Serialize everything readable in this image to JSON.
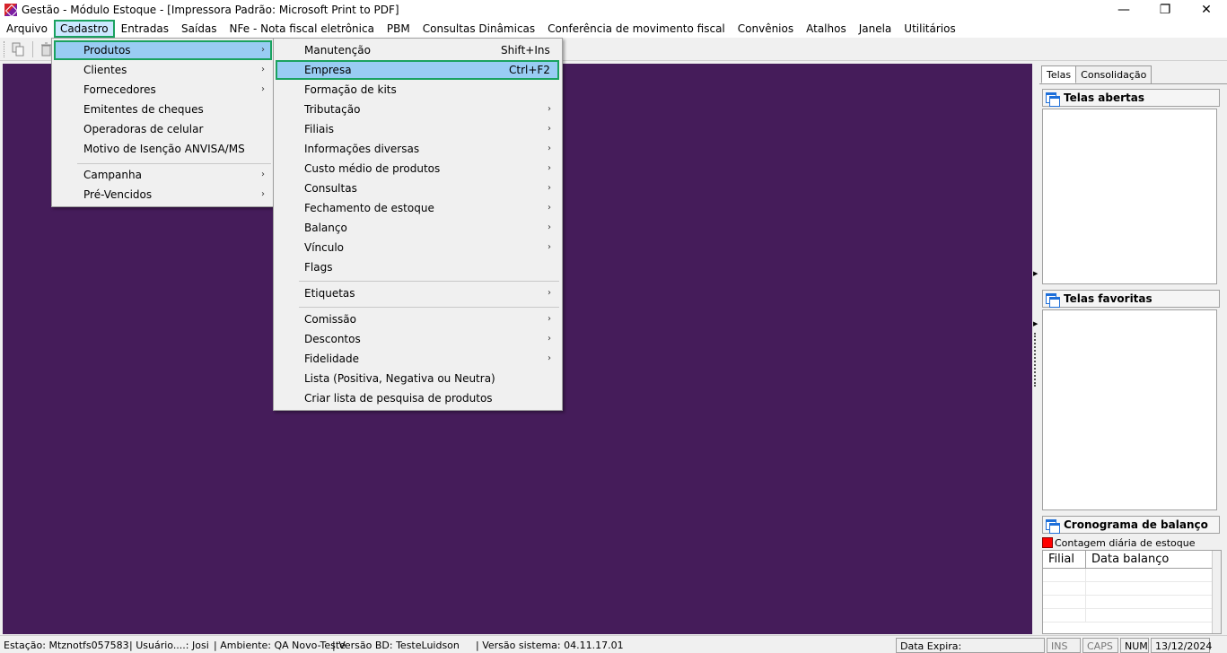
{
  "window": {
    "title": "Gestão  - Módulo Estoque - [Impressora Padrão: Microsoft Print to PDF]",
    "controls": {
      "minimize": "—",
      "maximize": "❐",
      "close": "✕"
    }
  },
  "menubar": {
    "items": [
      "Arquivo",
      "Cadastro",
      "Entradas",
      "Saídas",
      "NFe - Nota fiscal eletrônica",
      "PBM",
      "Consultas Dinâmicas",
      "Conferência de movimento fiscal",
      "Convênios",
      "Atalhos",
      "Janela",
      "Utilitários"
    ],
    "active": "Cadastro"
  },
  "cadastro_menu": {
    "items": [
      {
        "label": "Produtos",
        "submenu": true
      },
      {
        "label": "Clientes",
        "submenu": true
      },
      {
        "label": "Fornecedores",
        "submenu": true
      },
      {
        "label": "Emitentes de cheques",
        "submenu": false
      },
      {
        "label": "Operadoras de celular",
        "submenu": false
      },
      {
        "label": "Motivo de Isenção ANVISA/MS",
        "submenu": false
      },
      {
        "label": "Campanha",
        "submenu": true
      },
      {
        "label": "Pré-Vencidos",
        "submenu": true
      }
    ],
    "highlighted": "Produtos"
  },
  "produtos_menu": {
    "items": [
      {
        "label": "Manutenção",
        "shortcut": "Shift+Ins",
        "submenu": false
      },
      {
        "label": "Empresa",
        "shortcut": "Ctrl+F2",
        "submenu": false
      },
      {
        "label": "Formação de kits",
        "shortcut": "",
        "submenu": false
      },
      {
        "label": "Tributação",
        "shortcut": "",
        "submenu": true
      },
      {
        "label": "Filiais",
        "shortcut": "",
        "submenu": true
      },
      {
        "label": "Informações diversas",
        "shortcut": "",
        "submenu": true
      },
      {
        "label": "Custo médio de produtos",
        "shortcut": "",
        "submenu": true
      },
      {
        "label": "Consultas",
        "shortcut": "",
        "submenu": true
      },
      {
        "label": "Fechamento de estoque",
        "shortcut": "",
        "submenu": true
      },
      {
        "label": "Balanço",
        "shortcut": "",
        "submenu": true
      },
      {
        "label": "Vínculo",
        "shortcut": "",
        "submenu": true
      },
      {
        "label": "Flags",
        "shortcut": "",
        "submenu": false
      },
      {
        "label": "Etiquetas",
        "shortcut": "",
        "submenu": true
      },
      {
        "label": "Comissão",
        "shortcut": "",
        "submenu": true
      },
      {
        "label": "Descontos",
        "shortcut": "",
        "submenu": true
      },
      {
        "label": "Fidelidade",
        "shortcut": "",
        "submenu": true
      },
      {
        "label": "Lista (Positiva, Negativa ou Neutra)",
        "shortcut": "",
        "submenu": false
      },
      {
        "label": "Criar lista de pesquisa de produtos",
        "shortcut": "",
        "submenu": false
      }
    ],
    "highlighted": "Empresa"
  },
  "right_panel": {
    "tabs": [
      "Telas",
      "Consolidação"
    ],
    "selected_tab": "Telas",
    "telas_abertas": "Telas abertas",
    "telas_favoritas": "Telas favoritas",
    "cronograma": "Cronograma de balanço",
    "legend": "Contagem diária de estoque",
    "legend_color": "#ff0000",
    "grid_columns": [
      "Filial",
      "Data balanço"
    ]
  },
  "statusbar": {
    "estacao": "Estação: Mtznotfs057583",
    "usuario": "| Usuário....: Josi",
    "ambiente": "| Ambiente: QA Novo-Teste",
    "versao_bd": "| Versão BD: TesteLuidson",
    "versao_sistema": "| Versão sistema: 04.11.17.01",
    "data_expira": "Data Expira:",
    "ins": "INS",
    "caps": "CAPS",
    "num": "NUM",
    "date": "13/12/2024"
  },
  "colors": {
    "desktop": "#451c5a",
    "highlight_border": "#1aa260",
    "highlight_fill": "#99ccf3"
  }
}
